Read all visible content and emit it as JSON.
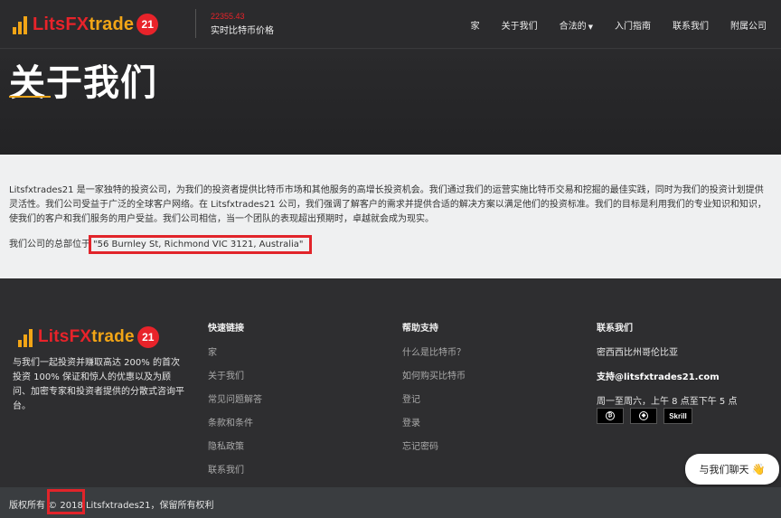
{
  "header": {
    "logo": {
      "part1": "Lits",
      "part2": "FX",
      "part3": "trade",
      "badge": "21"
    },
    "price": {
      "value": "22355.43",
      "label": "实时比特币价格"
    },
    "nav": [
      {
        "label": "家"
      },
      {
        "label": "关于我们"
      },
      {
        "label": "合法的"
      },
      {
        "label": "入门指南"
      },
      {
        "label": "联系我们"
      },
      {
        "label": "附属公司"
      }
    ]
  },
  "hero": {
    "title": "关于我们"
  },
  "about": {
    "paragraph": "Litsfxtrades21 是一家独特的投资公司，为我们的投资者提供比特币市场和其他服务的高增长投资机会。我们通过我们的运营实施比特币交易和挖掘的最佳实践，同时为我们的投资计划提供灵活性。我们公司受益于广泛的全球客户网络。在 Litsfxtrades21 公司，我们强调了解客户的需求并提供合适的解决方案以满足他们的投资标准。我们的目标是利用我们的专业知识和知识，使我们的客户和我们服务的用户受益。我们公司相信，当一个团队的表现超出预期时，卓越就会成为现实。",
    "address_prefix": "我们公司的总部位于",
    "address": "\"56 Burnley St, Richmond VIC 3121, Australia\""
  },
  "footer": {
    "description": "与我们一起投资并赚取高达 200% 的首次投资 100% 保证和惊人的优惠以及为顾问、加密专家和投资者提供的分散式咨询平台。",
    "quick_links": {
      "title": "快速链接",
      "items": [
        {
          "label": "家"
        },
        {
          "label": "关于我们"
        },
        {
          "label": "常见问题解答"
        },
        {
          "label": "条款和条件"
        },
        {
          "label": "隐私政策"
        },
        {
          "label": "联系我们"
        }
      ]
    },
    "help": {
      "title": "帮助支持",
      "items": [
        {
          "label": "什么是比特币？"
        },
        {
          "label": "如何购买比特币"
        },
        {
          "label": "登记"
        },
        {
          "label": "登录"
        },
        {
          "label": "忘记密码"
        }
      ]
    },
    "contact": {
      "title": "联系我们",
      "location": "密西西比州哥伦比亚",
      "email": "支持@litsfxtrades21.com",
      "hours": "周一至周六，上午 8 点至下午 5 点",
      "payments": [
        {
          "icon": "bitcoin-icon"
        },
        {
          "icon": "ethereum-icon"
        },
        {
          "label": "Skrill"
        }
      ]
    },
    "chat": {
      "label": "与我们聊天",
      "emoji": "👋"
    }
  },
  "copyright": {
    "text": "版权所有 © 2018 Litsfxtrades21，保留所有权利"
  },
  "colors": {
    "accent_red": "#e8232a",
    "accent_orange": "#f2a516",
    "highlight_box": "#e1242a"
  }
}
